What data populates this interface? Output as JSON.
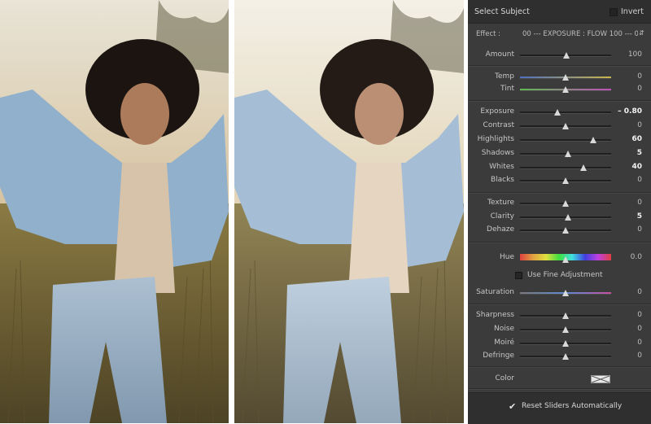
{
  "panel": {
    "title": "Select Subject",
    "invert_label": "Invert",
    "effect_label": "Effect :",
    "effect_value": "00 --- EXPOSURE : FLOW 100 --- 0...",
    "sliders": [
      {
        "key": "amount",
        "label": "Amount",
        "value": "100",
        "pos": 0.51
      },
      {
        "key": "temp",
        "label": "Temp",
        "value": "0",
        "pos": 0.5,
        "track": "temp"
      },
      {
        "key": "tint",
        "label": "Tint",
        "value": "0",
        "pos": 0.5,
        "track": "tint"
      },
      {
        "key": "exposure",
        "label": "Exposure",
        "value": "– 0.80",
        "pos": 0.41,
        "strong": true
      },
      {
        "key": "contrast",
        "label": "Contrast",
        "value": "0",
        "pos": 0.5
      },
      {
        "key": "highlights",
        "label": "Highlights",
        "value": "60",
        "pos": 0.8,
        "strong": true
      },
      {
        "key": "shadows",
        "label": "Shadows",
        "value": "5",
        "pos": 0.53,
        "strong": true
      },
      {
        "key": "whites",
        "label": "Whites",
        "value": "40",
        "pos": 0.7,
        "strong": true
      },
      {
        "key": "blacks",
        "label": "Blacks",
        "value": "0",
        "pos": 0.5
      },
      {
        "key": "texture",
        "label": "Texture",
        "value": "0",
        "pos": 0.5
      },
      {
        "key": "clarity",
        "label": "Clarity",
        "value": "5",
        "pos": 0.53,
        "strong": true
      },
      {
        "key": "dehaze",
        "label": "Dehaze",
        "value": "0",
        "pos": 0.5
      },
      {
        "key": "hue",
        "label": "Hue",
        "value": "0.0",
        "pos": 0.5,
        "track": "hue"
      },
      {
        "key": "saturation",
        "label": "Saturation",
        "value": "0",
        "pos": 0.5,
        "track": "sat"
      },
      {
        "key": "sharpness",
        "label": "Sharpness",
        "value": "0",
        "pos": 0.5
      },
      {
        "key": "noise",
        "label": "Noise",
        "value": "0",
        "pos": 0.5
      },
      {
        "key": "moire",
        "label": "Moiré",
        "value": "0",
        "pos": 0.5
      },
      {
        "key": "defringe",
        "label": "Defringe",
        "value": "0",
        "pos": 0.5
      }
    ],
    "fine_adjustment_label": "Use Fine Adjustment",
    "color_label": "Color",
    "reset_label": "Reset Sliders Automatically",
    "reset_checked_glyph": "✔"
  },
  "colors": {
    "panel_bg": "#3b3b3b",
    "header_bg": "#2f2f2f"
  },
  "icons": [
    "dropdown-arrow-icon",
    "checkmark-icon",
    "color-swatch-icon",
    "arrow-icon"
  ]
}
